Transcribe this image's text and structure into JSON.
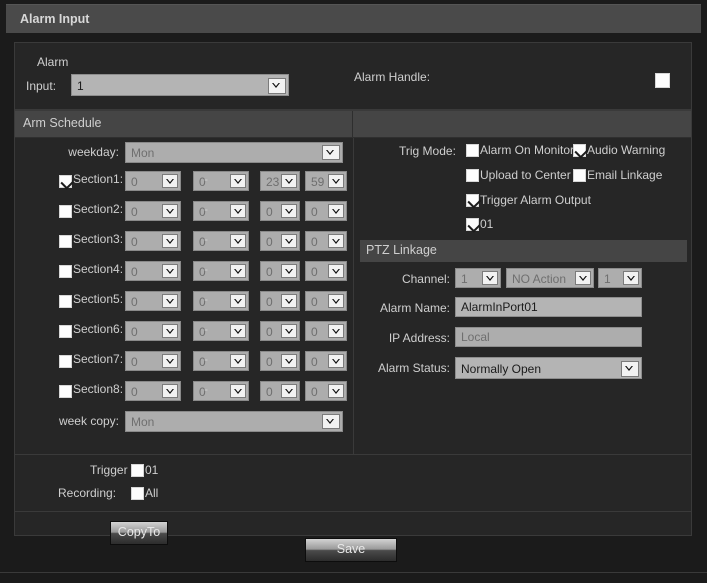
{
  "window": {
    "title": "Alarm Input"
  },
  "alarm_input": {
    "label_line1": "Alarm",
    "label_line2": "Input:",
    "value": "1",
    "handle_label": "Alarm Handle:",
    "handle_checked": false
  },
  "bands": {
    "arm_schedule": "Arm Schedule",
    "ptz_linkage": "PTZ Linkage"
  },
  "arm_schedule": {
    "weekday_label": "weekday:",
    "weekday_value": "Mon",
    "week_copy_label": "week copy:",
    "week_copy_value": "Mon",
    "dash": "-",
    "sections": [
      {
        "label": "Section1:",
        "checked": true,
        "start_h": "0",
        "start_m": "0",
        "end_h": "23",
        "end_m": "59"
      },
      {
        "label": "Section2:",
        "checked": false,
        "start_h": "0",
        "start_m": "0",
        "end_h": "0",
        "end_m": "0"
      },
      {
        "label": "Section3:",
        "checked": false,
        "start_h": "0",
        "start_m": "0",
        "end_h": "0",
        "end_m": "0"
      },
      {
        "label": "Section4:",
        "checked": false,
        "start_h": "0",
        "start_m": "0",
        "end_h": "0",
        "end_m": "0"
      },
      {
        "label": "Section5:",
        "checked": false,
        "start_h": "0",
        "start_m": "0",
        "end_h": "0",
        "end_m": "0"
      },
      {
        "label": "Section6:",
        "checked": false,
        "start_h": "0",
        "start_m": "0",
        "end_h": "0",
        "end_m": "0"
      },
      {
        "label": "Section7:",
        "checked": false,
        "start_h": "0",
        "start_m": "0",
        "end_h": "0",
        "end_m": "0"
      },
      {
        "label": "Section8:",
        "checked": false,
        "start_h": "0",
        "start_m": "0",
        "end_h": "0",
        "end_m": "0"
      }
    ]
  },
  "trig_mode": {
    "label": "Trig Mode:",
    "options": [
      {
        "label": "Alarm On Monitor",
        "checked": false
      },
      {
        "label": "Audio Warning",
        "checked": true
      },
      {
        "label": "Upload to Center",
        "checked": false
      },
      {
        "label": "Email Linkage",
        "checked": false
      },
      {
        "label": "Trigger Alarm Output",
        "checked": true
      },
      {
        "label": "01",
        "checked": true
      }
    ]
  },
  "ptz_linkage": {
    "channel_label": "Channel:",
    "channel_value": "1",
    "action_value": "NO Action",
    "preset_value": "1",
    "alarm_name_label": "Alarm Name:",
    "alarm_name_value": "AlarmInPort01",
    "ip_address_label": "IP Address:",
    "ip_address_value": "Local",
    "alarm_status_label": "Alarm Status:",
    "alarm_status_value": "Normally Open"
  },
  "trigger_recording": {
    "label_line1": "Trigger",
    "label_line2": "Recording:",
    "option_01": "01",
    "option_01_checked": false,
    "option_all": "All",
    "option_all_checked": false
  },
  "buttons": {
    "copy_to": "CopyTo",
    "save": "Save"
  },
  "colors": {
    "background": "#1b1b1b",
    "panel": "#262626",
    "band": "#454545",
    "titlebar": "#4a4a4a",
    "text": "#cfcfcf",
    "control": "#b4b4b4"
  }
}
